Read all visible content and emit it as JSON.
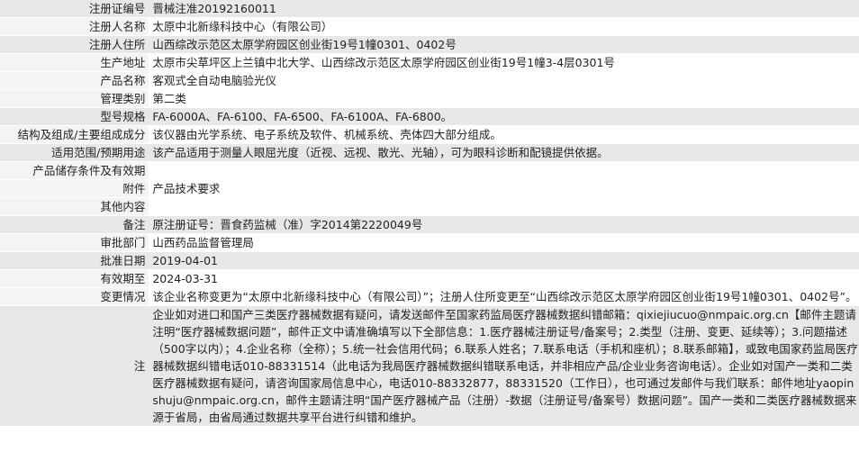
{
  "rows": [
    {
      "label": "注册证编号",
      "value": "晋械注准20192160011"
    },
    {
      "label": "注册人名称",
      "value": "太原中北新缘科技中心（有限公司）"
    },
    {
      "label": "注册人住所",
      "value": "山西综改示范区太原学府园区创业街19号1幢0301、0402号"
    },
    {
      "label": "生产地址",
      "value": "太原市尖草坪区上兰镇中北大学、山西综改示范区太原学府园区创业街19号1幢3-4层0301号"
    },
    {
      "label": "产品名称",
      "value": "客观式全自动电脑验光仪"
    },
    {
      "label": "管理类别",
      "value": "第二类"
    },
    {
      "label": "型号规格",
      "value": "FA-6000A、FA-6100、FA-6500、FA-6100A、FA-6800。"
    },
    {
      "label": "结构及组成/主要组成成分",
      "value": "该仪器由光学系统、电子系统及软件、机械系统、壳体四大部分组成。"
    },
    {
      "label": "适用范围/预期用途",
      "value": "该产品适用于测量人眼屈光度（近视、远视、散光、光轴），可为眼科诊断和配镜提供依据。"
    },
    {
      "label": "产品储存条件及有效期",
      "value": ""
    },
    {
      "label": "附件",
      "value": "产品技术要求"
    },
    {
      "label": "其他内容",
      "value": ""
    },
    {
      "label": "备注",
      "value": "原注册证号：晋食药监械（准）字2014第2220049号"
    },
    {
      "label": "审批部门",
      "value": "山西药品监督管理局"
    },
    {
      "label": "批准日期",
      "value": "2019-04-01"
    },
    {
      "label": "有效期至",
      "value": "2024-03-31"
    },
    {
      "label": "变更情况",
      "value": "该企业名称变更为“太原中北新缘科技中心（有限公司）”；注册人住所变更至“山西综改示范区太原学府园区创业街19号1幢0301、0402号”。"
    },
    {
      "label": "注",
      "value": "企业如对进口和国产三类医疗器械数据有疑问，请发送邮件至国家药监局医疗器械数据纠错邮箱：qixiejiucuo@nmpaic.org.cn【邮件主题请注明“医疗器械数据问题”，邮件正文中请准确填写以下全部信息：1.医疗器械注册证号/备案号；2.类型（注册、变更、延续等）；3.问题描述（500字以内）；4.企业名称（全称）；5.统一社会信用代码；6.联系人姓名；7.联系电话（手机和座机）；8.联系邮箱】，或致电国家药监局医疗器械数据纠错电话010-88331514（此电话为我局医疗器械数据纠错联系电话，并非相应产品/企业业务咨询电话）。企业如对国产一类和二类医疗器械数据有疑问，请咨询国家局信息中心，电话010-88332877，88331520（工作日），也可通过发邮件与我们联系：邮件地址yaopinshuju@nmpaic.org.cn，邮件主题请注明“国产医疗器械产品（注册）-数据（注册证号/备案号）数据问题”。国产一类和二类医疗器械数据来源于省局，由省局通过数据共享平台进行纠错和维护。"
    }
  ]
}
